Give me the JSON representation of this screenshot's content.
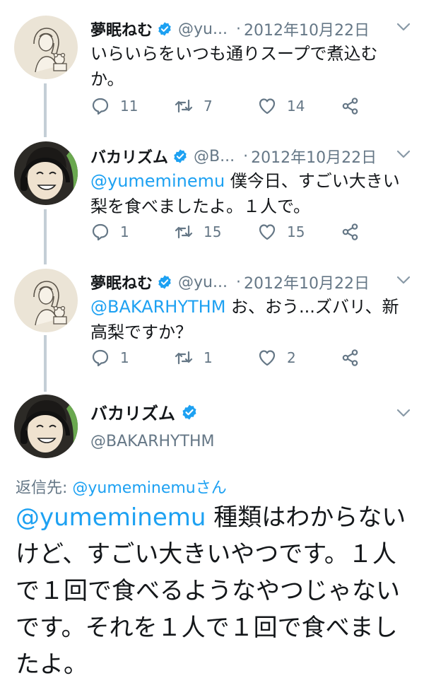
{
  "colors": {
    "accent": "#1da1f2",
    "muted": "#657786",
    "text": "#14171a",
    "thread_line": "#c4ced6"
  },
  "tweets": [
    {
      "name": "夢眠ねむ",
      "handle": "@yu...",
      "dot": "·",
      "date": "2012年10月22日",
      "mention": "",
      "text": "いらいらをいつも通りスープで煮込むか。",
      "replies": "11",
      "retweets": "7",
      "likes": "14"
    },
    {
      "name": "バカリズム",
      "handle": "@B...",
      "dot": "·",
      "date": "2012年10月22日",
      "mention": "@yumeminemu",
      "text": " 僕今日、すごい大きい梨を食べましたよ。１人で。",
      "replies": "1",
      "retweets": "15",
      "likes": "15"
    },
    {
      "name": "夢眠ねむ",
      "handle": "@yu...",
      "dot": "·",
      "date": "2012年10月22日",
      "mention": "@BAKARHYTHM",
      "text": " お、おう...ズバリ、新高梨ですか？",
      "replies": "1",
      "retweets": "1",
      "likes": "2"
    }
  ],
  "focus": {
    "name": "バカリズム",
    "handle": "@BAKARHYTHM",
    "reply_prefix": "返信先: ",
    "reply_mention": "@yumeminemu",
    "reply_suffix": "さん",
    "mention": "@yumeminemu",
    "text": " 種類はわからないけど、すごい大きいやつです。１人で１回で食べるようなやつじゃないです。それを１人で１回で食べましたよ。"
  },
  "icons": [
    "verified-badge-icon",
    "chevron-down-icon",
    "reply-icon",
    "retweet-icon",
    "like-icon",
    "share-icon"
  ]
}
